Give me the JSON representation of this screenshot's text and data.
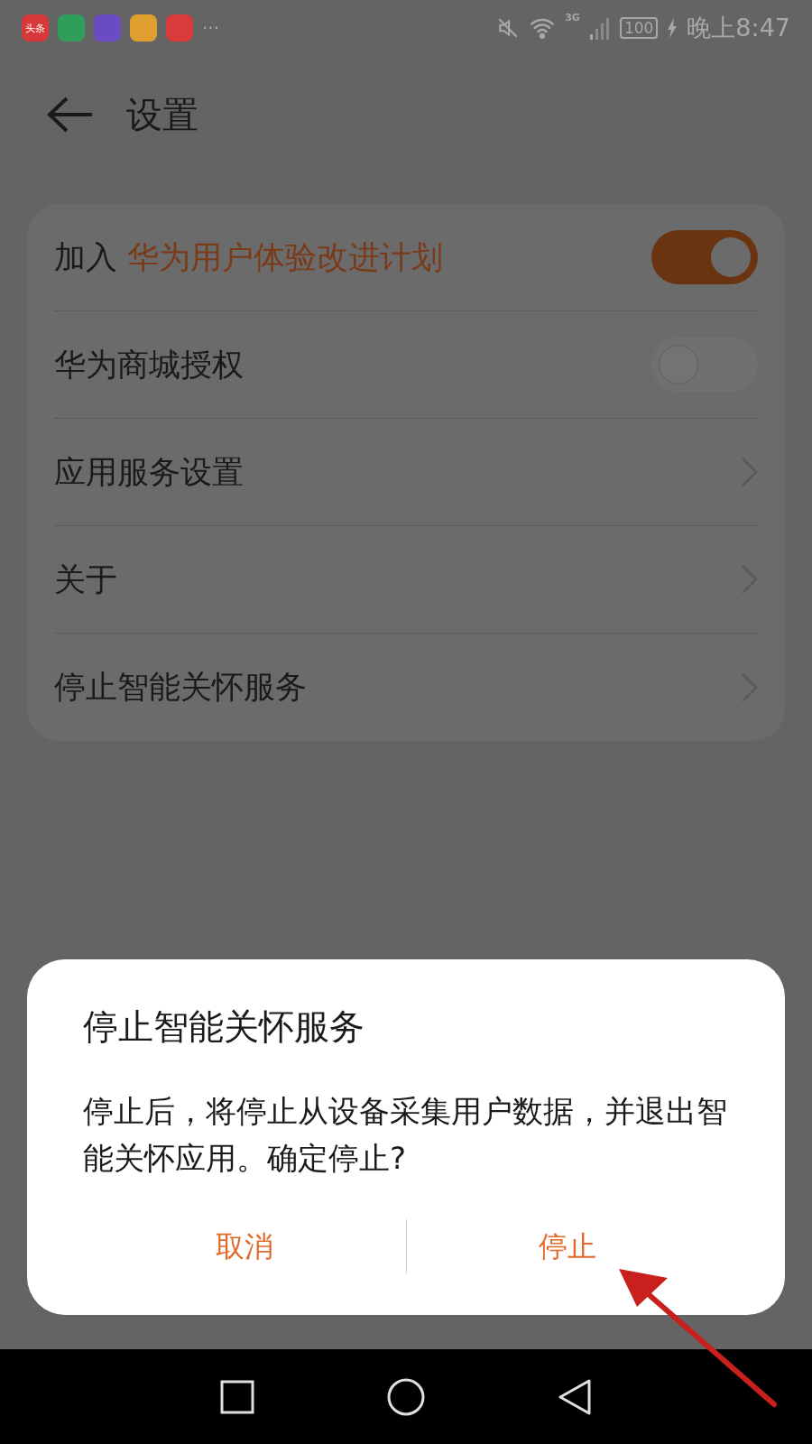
{
  "status_bar": {
    "app_icons": [
      {
        "label": "头条",
        "color": "#d9383a"
      },
      {
        "color": "#2e9e5a"
      },
      {
        "color": "#6a4bc4"
      },
      {
        "color": "#e0a030"
      },
      {
        "color": "#d93a3a"
      }
    ],
    "more": "···",
    "network": "3G",
    "battery": "100",
    "time": "晚上8:47"
  },
  "header": {
    "title": "设置"
  },
  "settings": [
    {
      "kind": "toggle",
      "prefix": "加入",
      "label": "华为用户体验改进计划",
      "on": true
    },
    {
      "kind": "toggle",
      "label": "华为商城授权",
      "on": false
    },
    {
      "kind": "link",
      "label": "应用服务设置"
    },
    {
      "kind": "link",
      "label": "关于"
    },
    {
      "kind": "link",
      "label": "停止智能关怀服务"
    }
  ],
  "dialog": {
    "title": "停止智能关怀服务",
    "message": "停止后，将停止从设备采集用户数据，并退出智能关怀应用。确定停止?",
    "buttons": [
      "取消",
      "停止"
    ]
  }
}
